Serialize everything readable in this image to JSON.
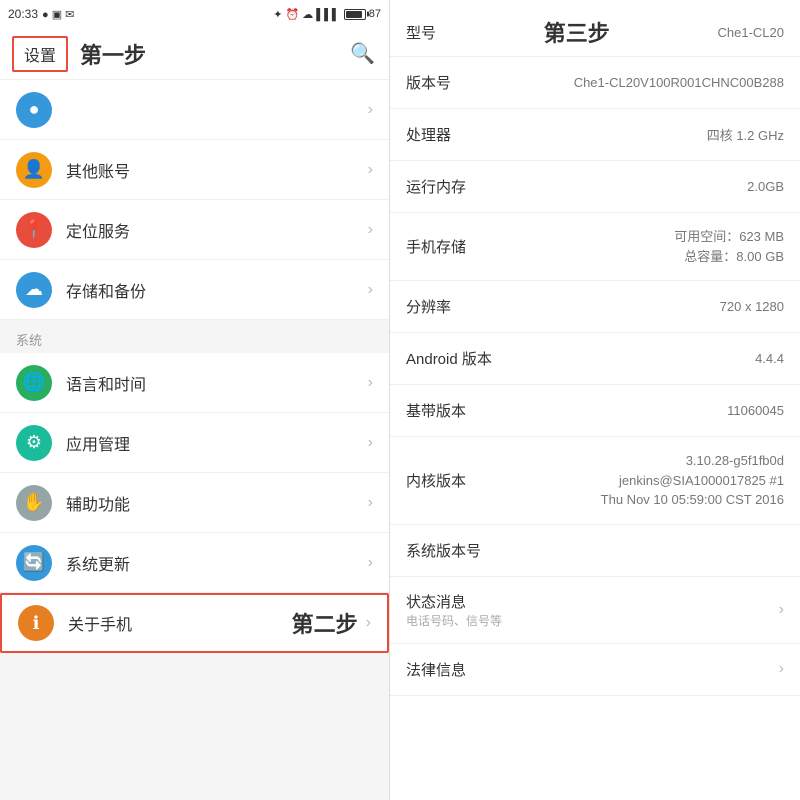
{
  "statusBar": {
    "time": "20:33",
    "battery": "87"
  },
  "leftPanel": {
    "settingsLabel": "设置",
    "stepOneLabel": "第一步",
    "searchIconLabel": "🔍",
    "sectionSystem": "系统",
    "menuItems": [
      {
        "id": "other-accounts",
        "label": "其他账号",
        "iconBg": "#f39c12",
        "iconChar": "👤"
      },
      {
        "id": "location",
        "label": "定位服务",
        "iconBg": "#e74c3c",
        "iconChar": "📍"
      },
      {
        "id": "storage",
        "label": "存储和备份",
        "iconBg": "#3498db",
        "iconChar": "☁"
      },
      {
        "id": "language",
        "label": "语言和时间",
        "iconBg": "#27ae60",
        "iconChar": "🌐",
        "section": true
      },
      {
        "id": "app-manage",
        "label": "应用管理",
        "iconBg": "#27ae60",
        "iconChar": "⚙"
      },
      {
        "id": "accessibility",
        "label": "辅助功能",
        "iconBg": "#7f8c8d",
        "iconChar": "✋"
      },
      {
        "id": "system-update",
        "label": "系统更新",
        "iconBg": "#3498db",
        "iconChar": "🔄"
      },
      {
        "id": "about-phone",
        "label": "关于手机",
        "iconBg": "#e67e22",
        "iconChar": "ℹ",
        "highlighted": true
      }
    ],
    "stepTwoLabel": "第二步"
  },
  "rightPanel": {
    "stepThreeLabel": "第三步",
    "modelLabel": "型号",
    "modelValue": "Che1-CL20",
    "rows": [
      {
        "id": "version-number",
        "label": "版本号",
        "value": "Che1-CL20V100R001CHNC00B288",
        "clickable": false
      },
      {
        "id": "processor",
        "label": "处理器",
        "value": "四核 1.2 GHz",
        "clickable": false
      },
      {
        "id": "ram",
        "label": "运行内存",
        "value": "2.0GB",
        "clickable": false
      },
      {
        "id": "storage",
        "label": "手机存储",
        "value": "可用空间：623 MB\n总容量：8.00 GB",
        "clickable": false,
        "multi": true
      },
      {
        "id": "resolution",
        "label": "分辨率",
        "value": "720 x 1280",
        "clickable": false
      },
      {
        "id": "android",
        "label": "Android 版本",
        "value": "4.4.4",
        "clickable": false
      },
      {
        "id": "baseband",
        "label": "基带版本",
        "value": "11060045",
        "clickable": false
      },
      {
        "id": "kernel",
        "label": "内核版本",
        "value": "3.10.28-g5f1fb0d\njenkins@SIA1000017825 #1\nThu Nov 10 05:59:00 CST 2016",
        "clickable": false,
        "multi": true
      },
      {
        "id": "sys-version",
        "label": "系统版本号",
        "value": "",
        "clickable": false
      },
      {
        "id": "status",
        "label": "状态消息",
        "sublabel": "电话号码、信号等",
        "value": "",
        "clickable": true
      },
      {
        "id": "legal",
        "label": "法律信息",
        "value": "",
        "clickable": true
      }
    ]
  }
}
